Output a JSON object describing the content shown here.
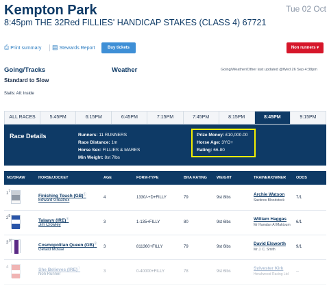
{
  "header": {
    "venue": "Kempton Park",
    "date": "Tue 02 Oct",
    "race_title": "8:45pm THE 32Red FILLIES' HANDICAP STAKES (CLASS 4) 67721"
  },
  "actions": {
    "print": "Print summary",
    "stewards": "Stewards Report",
    "buy_tickets": "Buy tickets",
    "non_runners": "Non runners"
  },
  "info": {
    "going_label": "Going/Tracks",
    "going_value": "Standard to Slow",
    "weather_label": "Weather",
    "updated_text": "Going/Weather/Other last updated @Wed 26 Sep 4:38pm",
    "stalls": "Stalls: All: Inside"
  },
  "tabs": [
    "ALL RACES",
    "5:45PM",
    "6:15PM",
    "6:45PM",
    "7:15PM",
    "7:45PM",
    "8:15PM",
    "8:45PM",
    "9:15PM"
  ],
  "active_tab": "8:45PM",
  "details": {
    "title": "Race Details",
    "runners_label": "Runners:",
    "runners_value": "11 RUNNERS",
    "distance_label": "Race Distance:",
    "distance_value": "1m",
    "sex_label": "Horse Sex:",
    "sex_value": "FILLIES & MARES",
    "min_weight_label": "Min Weight:",
    "min_weight_value": "8st 7lbs",
    "prize_label": "Prize Money:",
    "prize_value": "£10,000.00",
    "age_label": "Horse Age:",
    "age_value": "3YO+",
    "rating_label": "Rating:",
    "rating_value": "66-80"
  },
  "table": {
    "headers": [
      "NO/DRAW",
      "HORSE/JOCKEY",
      "AGE",
      "FORM-TYPE",
      "BHA RATING",
      "WEIGHT",
      "TRAINER/OWNER",
      "ODDS"
    ],
    "rows": [
      {
        "num": "1",
        "draw": "7",
        "horse": "Finishing Touch (GB)",
        "jockey": "Edward Greatrex",
        "age": "4",
        "form": "1330/-+D+FILLY",
        "bha": "79",
        "weight": "9st 8lbs",
        "trainer": "Archie Watson",
        "owner": "Saxtinos Bloodstock",
        "odds": "7/1"
      },
      {
        "num": "2",
        "draw": "8",
        "horse": "Talaayy (IRE)",
        "jockey": "Jim Crowley",
        "age": "3",
        "form": "1-135+FILLY",
        "bha": "80",
        "weight": "9st 6lbs",
        "trainer": "William Haggas",
        "owner": "Mr Hamdan Al Maktoum",
        "odds": "6/1"
      },
      {
        "num": "3",
        "draw": "10",
        "horse": "Cosmopolitan Queen (GB)",
        "jockey": "Gerald Mosse",
        "age": "3",
        "form": "811360+FILLY",
        "bha": "79",
        "weight": "9st 6lbs",
        "trainer": "David Elsworth",
        "owner": "Mr J. C. Smith",
        "odds": "9/1"
      },
      {
        "num": "4",
        "draw": "",
        "horse": "She Believes (IRE)",
        "jockey": "Non Runner",
        "age": "3",
        "form": "0-40000+FILLY",
        "bha": "78",
        "weight": "9st 6lbs",
        "trainer": "Sylvester Kirk",
        "owner": "Herahwood Racing Ltd",
        "odds": "--"
      }
    ]
  }
}
